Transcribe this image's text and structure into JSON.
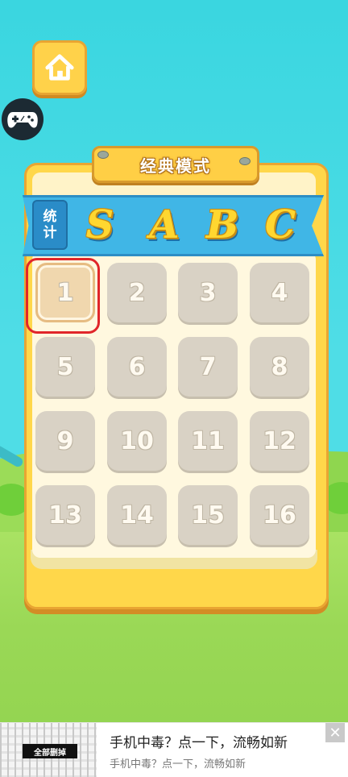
{
  "mode_title": "经典模式",
  "stats_label": [
    "统",
    "计"
  ],
  "grades": [
    "S",
    "A",
    "B",
    "C"
  ],
  "levels": [
    "1",
    "2",
    "3",
    "4",
    "5",
    "6",
    "7",
    "8",
    "9",
    "10",
    "11",
    "12",
    "13",
    "14",
    "15",
    "16"
  ],
  "selected_level": "1",
  "icons": {
    "home": "home-icon",
    "controller": "gamepad-icon",
    "close": "close-icon"
  },
  "ad": {
    "thumb_button": "全部删掉",
    "title": "手机中毒？点一下，流畅如新",
    "subtitle": "手机中毒？点一下，流畅如新",
    "close": "✕"
  },
  "colors": {
    "sky": "#4fdde6",
    "board": "#ffd74a",
    "ribbon": "#40b6e6",
    "level_locked": "#d9d2c5",
    "level_selected": "#f0d7ae",
    "highlight": "#e0262a"
  }
}
